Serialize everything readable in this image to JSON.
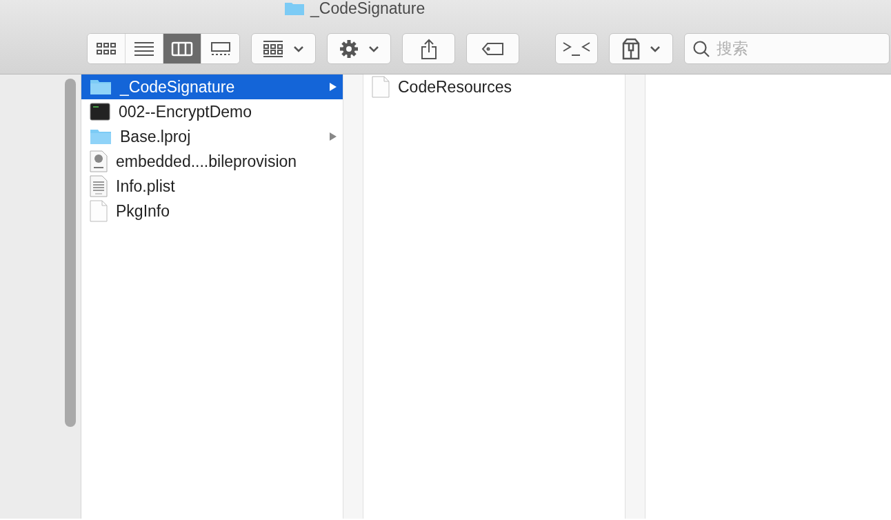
{
  "window": {
    "title": "_CodeSignature"
  },
  "toolbar": {
    "view_modes": [
      {
        "kind": "icons",
        "selected": false
      },
      {
        "kind": "list",
        "selected": false
      },
      {
        "kind": "columns",
        "selected": true
      },
      {
        "kind": "gallery",
        "selected": false
      }
    ],
    "search": {
      "placeholder": "搜索"
    }
  },
  "columns": [
    {
      "items": [
        {
          "name": "_CodeSignature",
          "kind": "folder",
          "has_children": true,
          "selected": true
        },
        {
          "name": "002--EncryptDemo",
          "kind": "exec",
          "has_children": false,
          "selected": false
        },
        {
          "name": "Base.lproj",
          "kind": "folder",
          "has_children": true,
          "selected": false
        },
        {
          "name": "embedded....bileprovision",
          "kind": "prov",
          "has_children": false,
          "selected": false
        },
        {
          "name": "Info.plist",
          "kind": "plist",
          "has_children": false,
          "selected": false
        },
        {
          "name": "PkgInfo",
          "kind": "file",
          "has_children": false,
          "selected": false
        }
      ]
    },
    {
      "items": [
        {
          "name": "CodeResources",
          "kind": "file",
          "has_children": false,
          "selected": false
        }
      ]
    }
  ]
}
